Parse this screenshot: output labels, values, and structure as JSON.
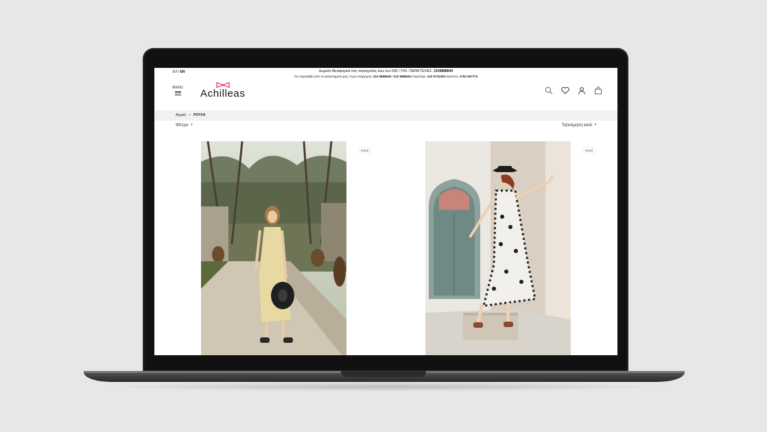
{
  "site": {
    "lang": {
      "el": "ΕΛ",
      "sep": " / ",
      "en": "EN"
    },
    "notice_line1": "Δωρεάν Μεταφορικά στις παραγγελίες άνω των 59€ / ΤΗΛ. ΠΑΡΑΓΓΕΛΙΕΣ: ",
    "notice_line1_phone": "2109888649",
    "notice_line2_prefix": "Για παραλαβή από τα καταστήματα μας: Άγιοι Ανάργυροι: ",
    "notice_line2_phone1": "210 9888649",
    "notice_line2_sep": " / ",
    "notice_line2_phone2": "210 9888261",
    "notice_line2_mid": " Περιστέρι: ",
    "notice_line2_phone3": "210 5731393",
    "notice_line2_mid2": " Ναύπλιο: ",
    "notice_line2_phone4": "2752 087773",
    "menu_label": "MENU",
    "logo_text": "Achilleas",
    "icons": [
      "search-icon",
      "heart-icon",
      "user-icon",
      "bag-icon"
    ],
    "breadcrumb": {
      "home": "Αρχική",
      "separator": ">",
      "current": "ΡΟΥΧΑ"
    },
    "filters_label": "Φίλτρα",
    "sort_label": "Ταξινόμηση κατά",
    "products": [
      {
        "badge": "SALE"
      },
      {
        "badge": "SALE"
      }
    ],
    "colors": {
      "logo_bow": "#e0237a",
      "breadcrumb_bg": "#f1f1f1"
    }
  }
}
